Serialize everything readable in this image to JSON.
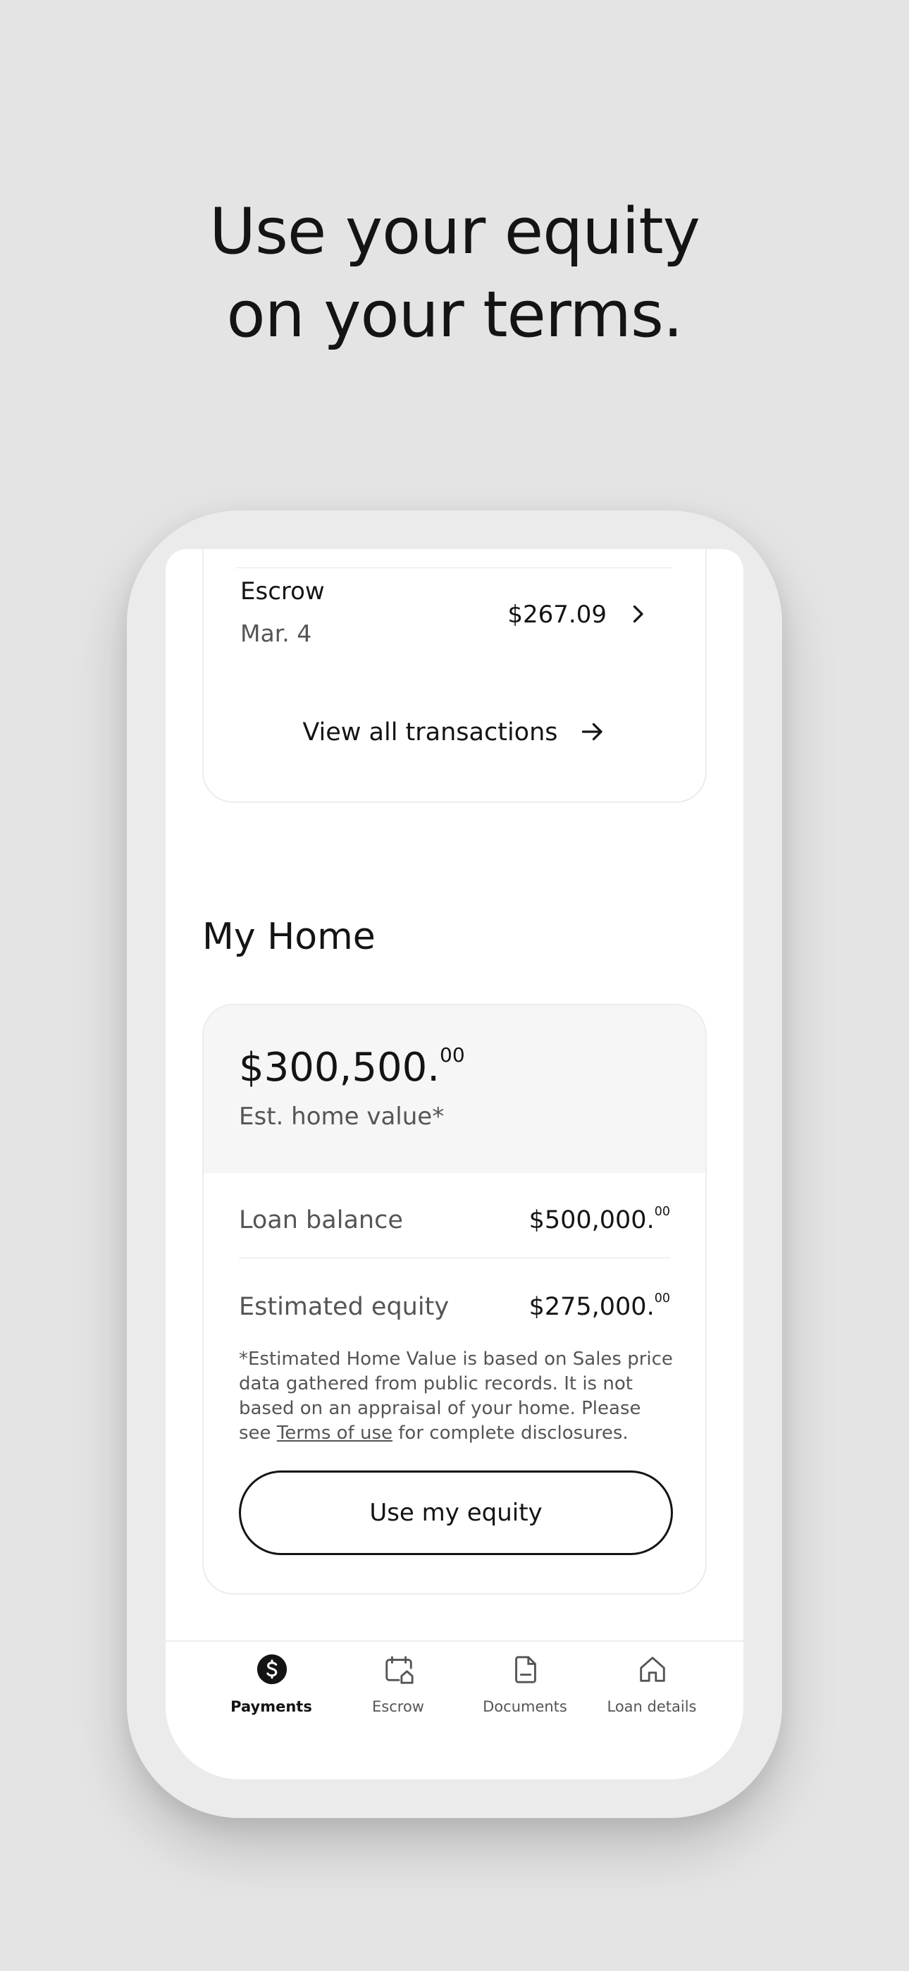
{
  "headline": {
    "line1": "Use your equity",
    "line2": "on your terms."
  },
  "transaction": {
    "title": "Escrow",
    "date": "Mar. 4",
    "amount": "$267.09"
  },
  "view_all_label": "View all transactions",
  "my_home": {
    "section_title": "My Home",
    "home_value_main": "$300,500.",
    "home_value_cents": "00",
    "home_value_label": "Est. home value*",
    "loan_balance_label": "Loan balance",
    "loan_balance_main": "$500,000.",
    "loan_balance_cents": "00",
    "equity_label": "Estimated equity",
    "equity_main": "$275,000.",
    "equity_cents": "00",
    "disclaimer_text": "*Estimated Home Value is based on Sales price data gathered from public records. It is not based on an appraisal of your home. Please see ",
    "disclaimer_link": "Terms of use",
    "disclaimer_tail": " for complete disclosures.",
    "cta_label": "Use my equity"
  },
  "tabs": [
    {
      "label": "Payments",
      "icon": "dollar-circle-icon",
      "active": true
    },
    {
      "label": "Escrow",
      "icon": "calendar-home-icon",
      "active": false
    },
    {
      "label": "Documents",
      "icon": "document-icon",
      "active": false
    },
    {
      "label": "Loan details",
      "icon": "home-icon",
      "active": false
    }
  ],
  "colors": {
    "background": "#e4e4e4",
    "text": "#141414",
    "muted": "#555555",
    "card_header": "#f6f6f6"
  }
}
